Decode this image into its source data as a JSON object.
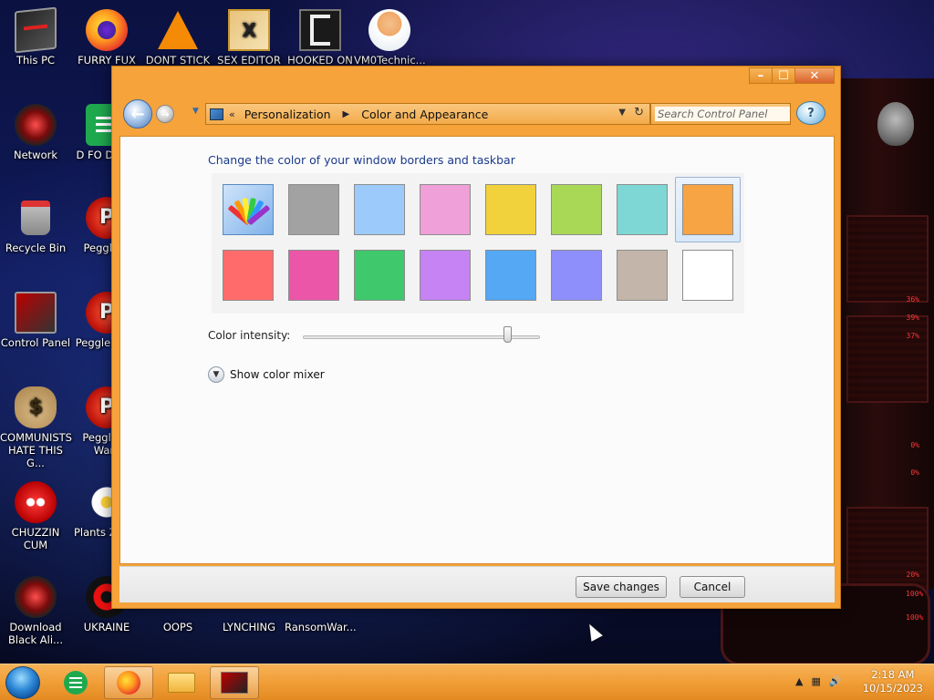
{
  "desktop": {
    "icons": [
      {
        "id": "this-pc",
        "label": "This PC",
        "icon": "computer-icon"
      },
      {
        "id": "furry-fux",
        "label": "FURRY FUX",
        "icon": "firefox-icon"
      },
      {
        "id": "dont-stick",
        "label": "DONT STICK",
        "icon": "vlc-icon"
      },
      {
        "id": "sex-editor",
        "label": "SEX EDITOR",
        "icon": "hxd-icon"
      },
      {
        "id": "hooked-on",
        "label": "HOOKED ON",
        "icon": "app-icon"
      },
      {
        "id": "vm0technic",
        "label": "VM0Technic...",
        "icon": "doctor-icon"
      },
      {
        "id": "network",
        "label": "Network",
        "icon": "network-icon"
      },
      {
        "id": "d-fo-dumb",
        "label": "D FO DUMB",
        "icon": "notes-icon"
      },
      {
        "id": "recycle-bin",
        "label": "Recycle Bin",
        "icon": "recycle-bin-icon"
      },
      {
        "id": "peggle-d",
        "label": "Peggle D",
        "icon": "peggle-icon"
      },
      {
        "id": "control-panel",
        "label": "Control Panel",
        "icon": "control-panel-icon"
      },
      {
        "id": "peggle-deluxe",
        "label": "Peggle Delu",
        "icon": "peggle-icon"
      },
      {
        "id": "communists",
        "label": "COMMUNISTS HATE THIS G...",
        "icon": "money-bag-icon"
      },
      {
        "id": "peggle-warcraft",
        "label": "Peggle of Warc",
        "icon": "peggle-icon"
      },
      {
        "id": "chuzzin",
        "label": "CHUZZIN CUM",
        "icon": "chuzzle-icon"
      },
      {
        "id": "plants-zombies",
        "label": "Plants Zomb",
        "icon": "flower-icon"
      },
      {
        "id": "download-alien",
        "label": "Download Black Ali...",
        "icon": "alienware-icon"
      },
      {
        "id": "ukraine",
        "label": "UKRAINE",
        "icon": "radiation-icon"
      },
      {
        "id": "oops",
        "label": "OOPS",
        "icon": "app-icon"
      },
      {
        "id": "lynching",
        "label": "LYNCHING",
        "icon": "app-icon"
      },
      {
        "id": "ransomware",
        "label": "RansomWar...",
        "icon": "app-icon"
      }
    ],
    "gadget_readings": [
      "36%",
      "39%",
      "37%",
      "0%",
      "0%",
      "20%",
      "100%",
      "100%"
    ]
  },
  "window": {
    "controls": {
      "minimize": "–",
      "maximize": "☐",
      "close": "✕"
    },
    "nav": {
      "back_glyph": "←",
      "forward_glyph": "→",
      "breadcrumb": [
        "Personalization",
        "Color and Appearance"
      ],
      "overflow_glyph": "«",
      "search_placeholder": "Search Control Panel"
    },
    "heading": "Change the color of your window borders and taskbar",
    "swatches": [
      {
        "name": "custom",
        "color": "custom"
      },
      {
        "name": "slate",
        "color": "#a2a2a2"
      },
      {
        "name": "sky",
        "color": "#9ccbfb"
      },
      {
        "name": "twilight",
        "color": "#f0a0d8"
      },
      {
        "name": "sun",
        "color": "#f2d23c"
      },
      {
        "name": "leaf",
        "color": "#a9d857"
      },
      {
        "name": "sea",
        "color": "#7ed7d4"
      },
      {
        "name": "pumpkin",
        "color": "#f6a444",
        "selected": true
      },
      {
        "name": "blush",
        "color": "#ff6b6b"
      },
      {
        "name": "fuchsia",
        "color": "#ec56a8"
      },
      {
        "name": "emerald",
        "color": "#3fc86c"
      },
      {
        "name": "violet",
        "color": "#c583f3"
      },
      {
        "name": "blue",
        "color": "#54a8f4"
      },
      {
        "name": "lavender",
        "color": "#8f8ffb"
      },
      {
        "name": "taupe",
        "color": "#c3b5a9"
      },
      {
        "name": "frost",
        "color": "#ffffff"
      }
    ],
    "intensity_label": "Color intensity:",
    "intensity_value": 0.86,
    "mixer_toggle": "Show color mixer",
    "save_label": "Save changes",
    "cancel_label": "Cancel"
  },
  "taskbar": {
    "clock_time": "2:18 AM",
    "clock_date": "10/15/2023",
    "tray_arrow": "▲"
  },
  "colors": {
    "accent": "#f5a33a",
    "heading": "#1a3a8c"
  }
}
